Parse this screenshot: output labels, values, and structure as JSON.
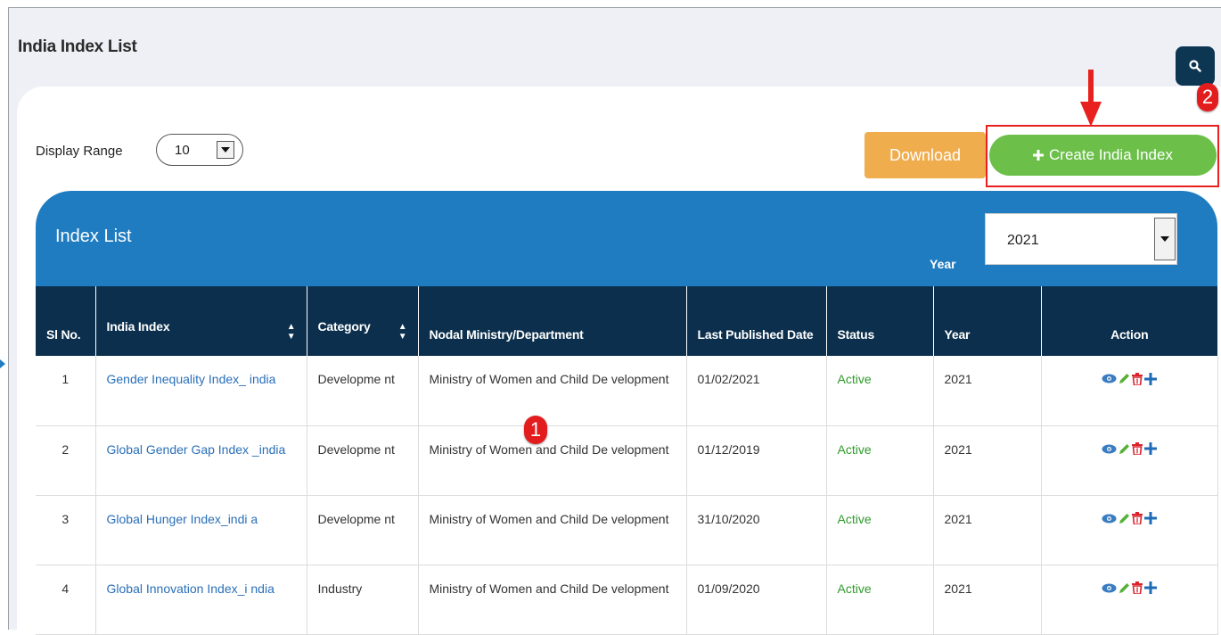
{
  "page": {
    "title": "India Index List"
  },
  "controls": {
    "display_range_label": "Display Range",
    "display_range_value": "10",
    "download_label": "Download",
    "create_label": "Create India Index"
  },
  "annotations": {
    "badge_1": "1",
    "badge_2": "2"
  },
  "list": {
    "title": "Index List",
    "year_label": "Year",
    "year_value": "2021",
    "columns": [
      "Sl No.",
      "India Index",
      "Category",
      "Nodal Ministry/Department",
      "Last Published Date",
      "Status",
      "Year",
      "Action"
    ],
    "rows": [
      {
        "sno": "1",
        "index": "Gender Inequality Index_ india",
        "category": "Developme nt",
        "ministry": "Ministry of Women and Child De velopment",
        "date": "01/02/2021",
        "status": "Active",
        "year": "2021"
      },
      {
        "sno": "2",
        "index": "Global Gender Gap Index _india",
        "category": "Developme nt",
        "ministry": "Ministry of Women and Child De velopment",
        "date": "01/12/2019",
        "status": "Active",
        "year": "2021"
      },
      {
        "sno": "3",
        "index": "Global Hunger Index_indi a",
        "category": "Developme nt",
        "ministry": "Ministry of Women and Child De velopment",
        "date": "31/10/2020",
        "status": "Active",
        "year": "2021"
      },
      {
        "sno": "4",
        "index": "Global Innovation Index_i ndia",
        "category": "Industry",
        "ministry": "Ministry of Women and Child De velopment",
        "date": "01/09/2020",
        "status": "Active",
        "year": "2021"
      }
    ]
  },
  "colors": {
    "header_blue": "#1f7cc1",
    "table_header": "#0b2f4c",
    "download": "#f0ad4e",
    "create": "#6cc04a",
    "status_active": "#2e9a2a",
    "link": "#2a6fb8",
    "annotation": "#e31d1d"
  }
}
